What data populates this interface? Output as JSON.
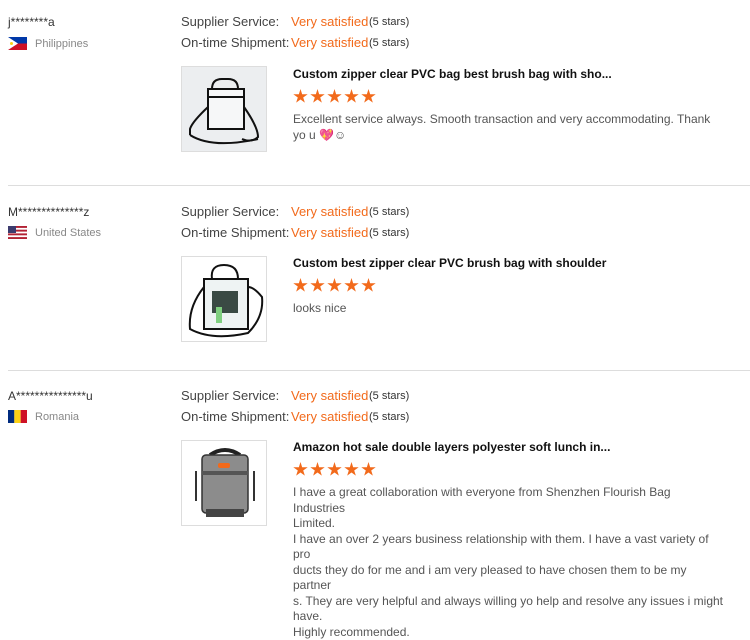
{
  "labels": {
    "supplier_service": "Supplier Service:",
    "ontime_shipment": "On-time Shipment:"
  },
  "reviews": [
    {
      "user": "j********a",
      "country": "Philippines",
      "supplier_rating": "Very satisfied",
      "supplier_stars": "(5 stars)",
      "shipment_rating": "Very satisfied",
      "shipment_stars": "(5 stars)",
      "product_title": "Custom zipper clear PVC bag best brush bag with sho...",
      "product_rating": 5,
      "comment": "Excellent service always. Smooth transaction and very accommodating. Thank yo u 💖☺"
    },
    {
      "user": "M**************z",
      "country": "United States",
      "supplier_rating": "Very satisfied",
      "supplier_stars": "(5 stars)",
      "shipment_rating": "Very satisfied",
      "shipment_stars": "(5 stars)",
      "product_title": "Custom best zipper clear PVC brush bag with shoulder",
      "product_rating": 5,
      "comment": "looks nice"
    },
    {
      "user": "A***************u",
      "country": "Romania",
      "supplier_rating": "Very satisfied",
      "supplier_stars": "(5 stars)",
      "shipment_rating": "Very satisfied",
      "shipment_stars": "(5 stars)",
      "product_title": "Amazon hot sale double layers polyester soft lunch in...",
      "product_rating": 5,
      "comment_lines": [
        "I have a great collaboration with everyone from Shenzhen Flourish Bag Industries",
        "Limited.",
        "I have an over 2 years business relationship with them. I have a vast variety of pro",
        "ducts they do for me and i am very pleased to have chosen them to be my partner",
        "s. They are very helpful and always willing yo help and resolve any issues i might",
        "have.",
        "Highly recommended."
      ]
    }
  ],
  "colors": {
    "accent": "#f26a1b",
    "divider": "#dddddd"
  }
}
